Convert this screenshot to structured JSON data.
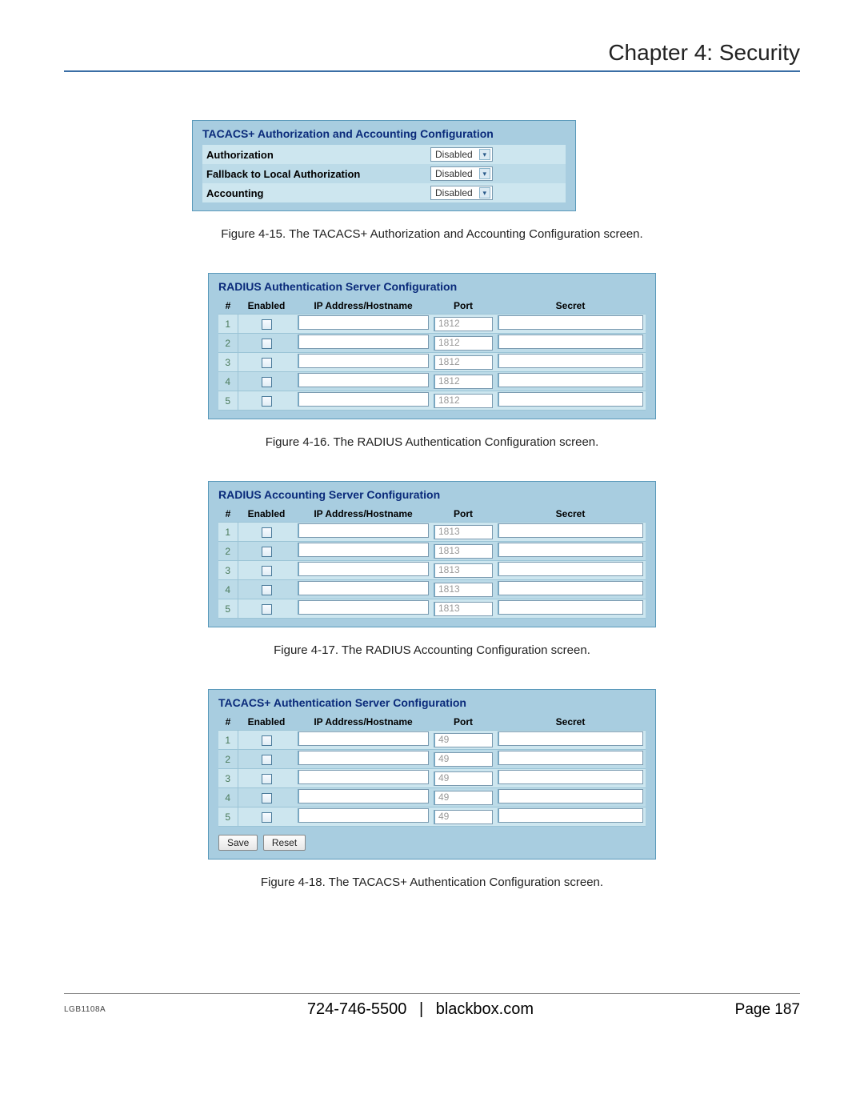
{
  "header": {
    "chapter_title": "Chapter 4: Security"
  },
  "panel1": {
    "title": "TACACS+ Authorization and Accounting Configuration",
    "rows": [
      {
        "label": "Authorization",
        "value": "Disabled"
      },
      {
        "label": "Fallback to Local Authorization",
        "value": "Disabled"
      },
      {
        "label": "Accounting",
        "value": "Disabled"
      }
    ]
  },
  "caption1": "Figure 4-15. The TACACS+ Authorization and Accounting Configuration screen.",
  "columns": {
    "num": "#",
    "enabled": "Enabled",
    "ip": "IP Address/Hostname",
    "port": "Port",
    "secret": "Secret"
  },
  "panel2": {
    "title": "RADIUS Authentication Server Configuration",
    "rows": [
      {
        "num": "1",
        "port": "1812"
      },
      {
        "num": "2",
        "port": "1812"
      },
      {
        "num": "3",
        "port": "1812"
      },
      {
        "num": "4",
        "port": "1812"
      },
      {
        "num": "5",
        "port": "1812"
      }
    ]
  },
  "caption2": "Figure 4-16. The RADIUS Authentication Configuration screen.",
  "panel3": {
    "title": "RADIUS Accounting Server Configuration",
    "rows": [
      {
        "num": "1",
        "port": "1813"
      },
      {
        "num": "2",
        "port": "1813"
      },
      {
        "num": "3",
        "port": "1813"
      },
      {
        "num": "4",
        "port": "1813"
      },
      {
        "num": "5",
        "port": "1813"
      }
    ]
  },
  "caption3": "Figure 4-17. The RADIUS Accounting Configuration screen.",
  "panel4": {
    "title": "TACACS+ Authentication Server Configuration",
    "rows": [
      {
        "num": "1",
        "port": "49"
      },
      {
        "num": "2",
        "port": "49"
      },
      {
        "num": "3",
        "port": "49"
      },
      {
        "num": "4",
        "port": "49"
      },
      {
        "num": "5",
        "port": "49"
      }
    ]
  },
  "buttons": {
    "save": "Save",
    "reset": "Reset"
  },
  "caption4": "Figure 4-18. The TACACS+ Authentication Configuration screen.",
  "footer": {
    "model": "LGB1108A",
    "phone": "724-746-5500",
    "site": "blackbox.com",
    "page": "Page 187"
  }
}
